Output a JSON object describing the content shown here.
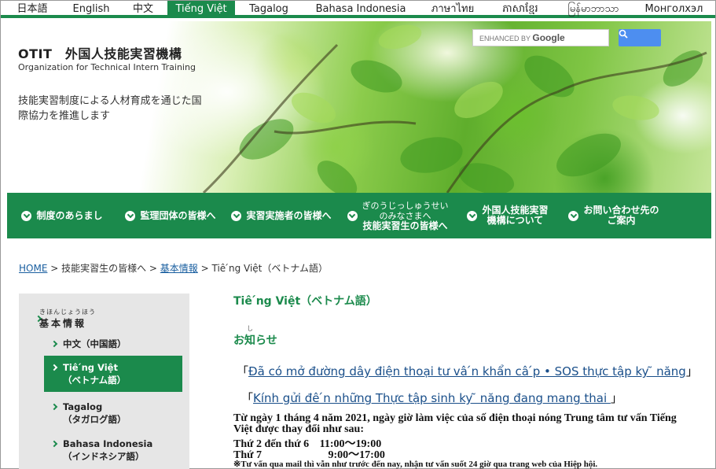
{
  "languages": [
    {
      "label": "日本語",
      "active": false
    },
    {
      "label": "English",
      "active": false
    },
    {
      "label": "中文",
      "active": false
    },
    {
      "label": "Tiếng Việt",
      "active": true
    },
    {
      "label": "Tagalog",
      "active": false
    },
    {
      "label": "Bahasa Indonesia",
      "active": false
    },
    {
      "label": "ภาษาไทย",
      "active": false
    },
    {
      "label": "ភាសាខ្មែរ",
      "active": false
    },
    {
      "label": "မြန်မာဘာသာ",
      "active": false
    },
    {
      "label": "Монголхэл",
      "active": false
    }
  ],
  "header": {
    "logo": "OTIT　外国人技能実習機構",
    "logo_sub": "Organization for Technical Intern Training",
    "tagline": "技能実習制度による人材育成を通じた国際協力を推進します",
    "search_placeholder_prefix": "ENHANCED BY",
    "search_placeholder_brand": "Google"
  },
  "nav": [
    {
      "label": "制度のあらまし"
    },
    {
      "label": "監理団体の皆様へ"
    },
    {
      "label": "実習実施者の皆様へ"
    },
    {
      "label_ruby": "ぎのうじっしゅうせい",
      "label_line2": "のみなさまへ",
      "label_line3": "技能実習生の皆様へ"
    },
    {
      "label_line1": "外国人技能実習",
      "label_line2": "機構について"
    },
    {
      "label_line1": "お問い合わせ先の",
      "label_line2": "ご案内"
    }
  ],
  "breadcrumb": {
    "home": "HOME",
    "sep1": " > 技能実習生の皆様へ > ",
    "basic": "基本情報",
    "sep2": " > Tiê ́ng Việt（ベトナム語）"
  },
  "sidebar": {
    "head_ruby": "きほんじょうほう",
    "head_label": "基本情報",
    "items": [
      {
        "line1": "中文（中国語）",
        "line2": ""
      },
      {
        "line1": "Tiê ́ng Việt",
        "line2": "（ベトナム語）"
      },
      {
        "line1": "Tagalog",
        "line2": "（タガログ語）"
      },
      {
        "line1": "Bahasa Indonesia",
        "line2": "（インドネシア語）"
      }
    ]
  },
  "main": {
    "title": "Tiê ́ng Việt（ベトナム語）",
    "notice_ruby": "し",
    "notice_title": "お知らせ",
    "link1": "Đã có mở đường dây điện thoại tư vâ ́n khẩn câ ́p • SOS thực tập ky ̃ năng",
    "link2": "Kính gửi đê ́n những Thực tập sinh ky ̃ năng đang mang thai ",
    "para1": "Từ ngày 1 tháng 4 năm 2021, ngày giờ làm việc của số điện thoại nóng Trung tâm tư vấn Tiếng",
    "para2": "Việt được thay đổi như sau:",
    "row1_day": "Thứ 2 đến thứ 6",
    "row1_time": "11:00～19:00",
    "row2_day": "Thứ 7",
    "row2_time": "9:00～17:00",
    "note": "※Tư vấn qua mail thì vẫn như trước đến nay, nhận tư vấn suốt 24 giờ qua trang web của Hiệp hội.",
    "bracket_open": "「",
    "bracket_close": "」"
  },
  "colors": {
    "accent": "#1b8a4c",
    "link": "#1a4f8a",
    "sidebar_bg": "#e6e6e6",
    "search_button": "#4d8ef0"
  }
}
